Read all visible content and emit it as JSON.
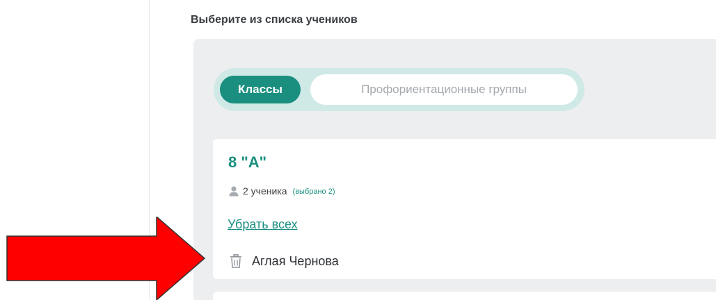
{
  "header": {
    "title": "Выберите из списка учеников"
  },
  "tabs": [
    {
      "label": "Классы",
      "active": true
    },
    {
      "label": "Профориентационные группы",
      "active": false
    }
  ],
  "class_card": {
    "name": "8 \"А\"",
    "student_count": "2 ученика",
    "selected_label": "(выбрано 2)",
    "remove_all_label": "Убрать всех",
    "students": [
      {
        "name": "Аглая Чернова"
      }
    ]
  },
  "icons": {
    "person": "person-icon",
    "trash": "trash-icon"
  },
  "colors": {
    "accent": "#1a8f80",
    "segment_bg": "#cfe9e6",
    "panel_bg": "#eceef0",
    "arrow": "#ff0000"
  }
}
